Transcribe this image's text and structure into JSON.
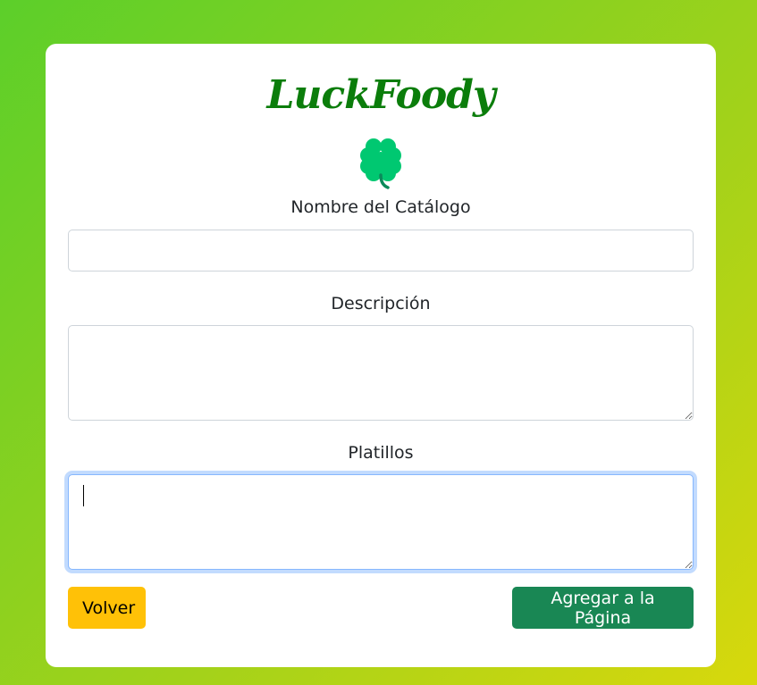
{
  "brand": {
    "title": "LuckFoody",
    "logo_icon": "four-leaf-clover-icon",
    "logo_color": "#00c871"
  },
  "form": {
    "nombre_label": "Nombre del Catálogo",
    "nombre_value": "",
    "descripcion_label": "Descripción",
    "descripcion_value": "",
    "platillos_label": "Platillos",
    "platillos_value": ""
  },
  "actions": {
    "volver_label": "Volver",
    "agregar_label": "Agregar a la Página"
  },
  "colors": {
    "brand_text": "#0b7d0b",
    "volver_button": "#ffc107",
    "agregar_button": "#198754",
    "focus_ring": "#86b7fe"
  }
}
